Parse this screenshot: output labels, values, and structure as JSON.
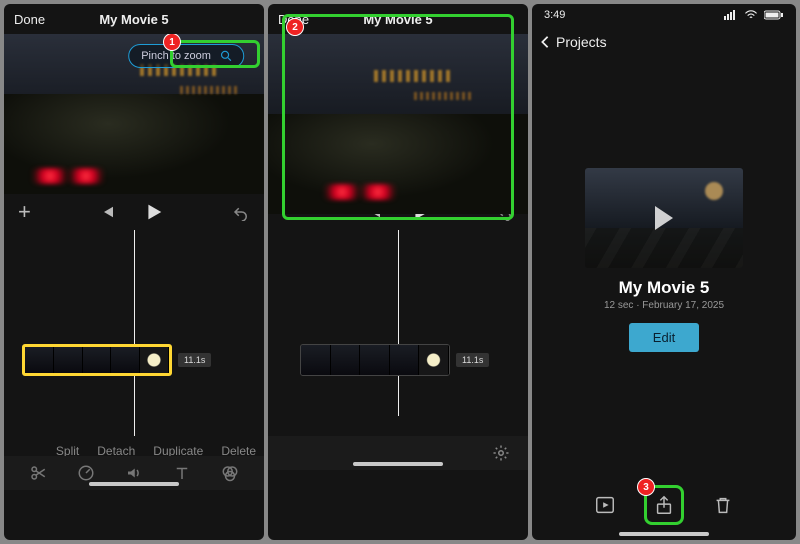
{
  "panel1": {
    "done": "Done",
    "title": "My Movie 5",
    "pinch": "Pinch to zoom",
    "duration": "11.1s",
    "actions": {
      "split": "Split",
      "detach": "Detach",
      "duplicate": "Duplicate",
      "delete": "Delete"
    }
  },
  "panel2": {
    "done": "Done",
    "title": "My Movie 5",
    "duration": "11.1s"
  },
  "panel3": {
    "time": "3:49",
    "back": "Projects",
    "title": "My Movie 5",
    "meta": "12 sec · February 17, 2025",
    "edit": "Edit"
  },
  "markers": {
    "m1": "1",
    "m2": "2",
    "m3": "3"
  }
}
